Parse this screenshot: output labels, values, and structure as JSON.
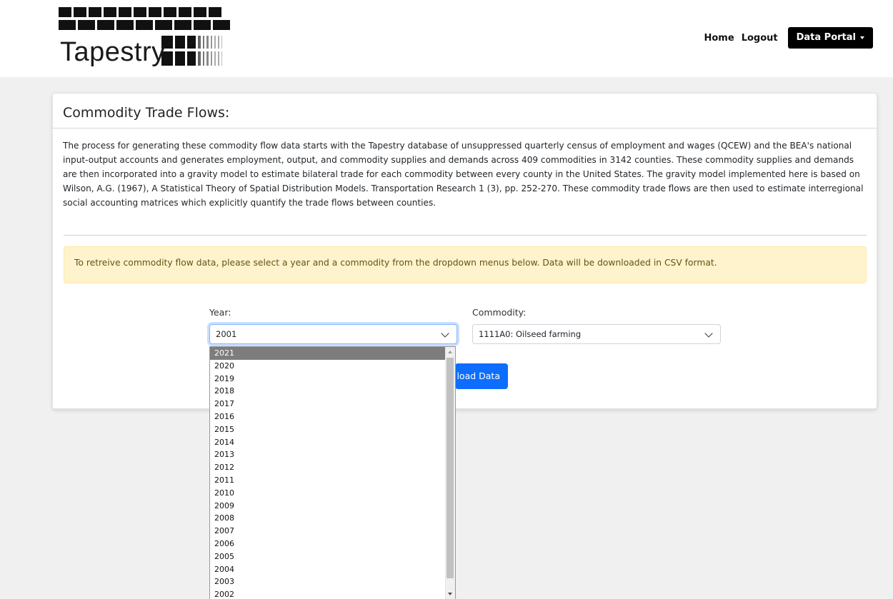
{
  "header": {
    "logo_text": "Tapestry",
    "nav": {
      "home": "Home",
      "logout": "Logout",
      "data_portal": "Data Portal"
    }
  },
  "card": {
    "title": "Commodity Trade Flows:",
    "description": "The process for generating these commodity flow data starts with the Tapestry database of unsuppressed quarterly census of employment and wages (QCEW) and the BEA's national input-output accounts and generates employment, output, and commodity supplies and demands across 409 commodities in 3142 counties. These commodity supplies and demands are then incorporated into a gravity model to estimate bilateral trade for each commodity between every county in the United States. The gravity model implemented here is based on Wilson, A.G. (1967), A Statistical Theory of Spatial Distribution Models. Transportation Research 1 (3), pp. 252-270. These commodity trade flows are then used to estimate interregional social accounting matrices which explicitly quantify the trade flows between counties.",
    "alert": "To retreive commodity flow data, please select a year and a commodity from the dropdown menus below. Data will be downloaded in CSV format.",
    "year_label": "Year:",
    "year_value": "2001",
    "commodity_label": "Commodity:",
    "commodity_value": "1111A0: Oilseed farming",
    "download_label": "load Data"
  },
  "year_options": [
    "2021",
    "2020",
    "2019",
    "2018",
    "2017",
    "2016",
    "2015",
    "2014",
    "2013",
    "2012",
    "2011",
    "2010",
    "2009",
    "2008",
    "2007",
    "2006",
    "2005",
    "2004",
    "2003",
    "2002"
  ],
  "highlighted_option": "2021",
  "colors": {
    "primary": "#0d6efd",
    "alert_bg": "#fff3cd",
    "alert_text": "#665312",
    "option_highlight": "#7d7d7d"
  },
  "icons": {
    "dropdown_caret": "caret-down-icon",
    "select_chevron": "chevron-down-icon"
  }
}
